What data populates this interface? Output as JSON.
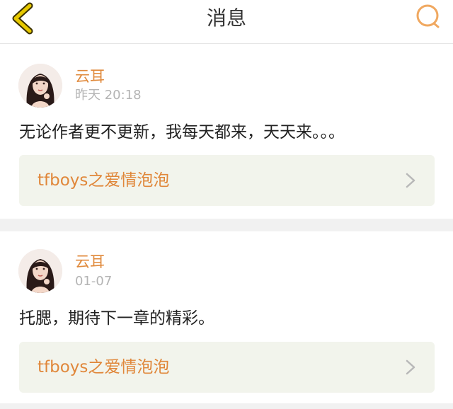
{
  "header": {
    "title": "消息",
    "back_icon": "chevron-left-icon",
    "search_icon": "search-icon",
    "accent": "#e0c300",
    "search_color": "#f0a860"
  },
  "messages": [
    {
      "author": "云耳",
      "time": "昨天 20:18",
      "content": "无论作者更不更新，我每天都来，天天来。。。",
      "book": "tfboys之爱情泡泡"
    },
    {
      "author": "云耳",
      "time": "01-07",
      "content": "托腮，期待下一章的精彩。",
      "book": "tfboys之爱情泡泡"
    }
  ],
  "colors": {
    "name": "#e08a3c",
    "link_bg": "#f2f4ec",
    "link_text": "#e0873a",
    "divider": "#f1f1f1"
  }
}
